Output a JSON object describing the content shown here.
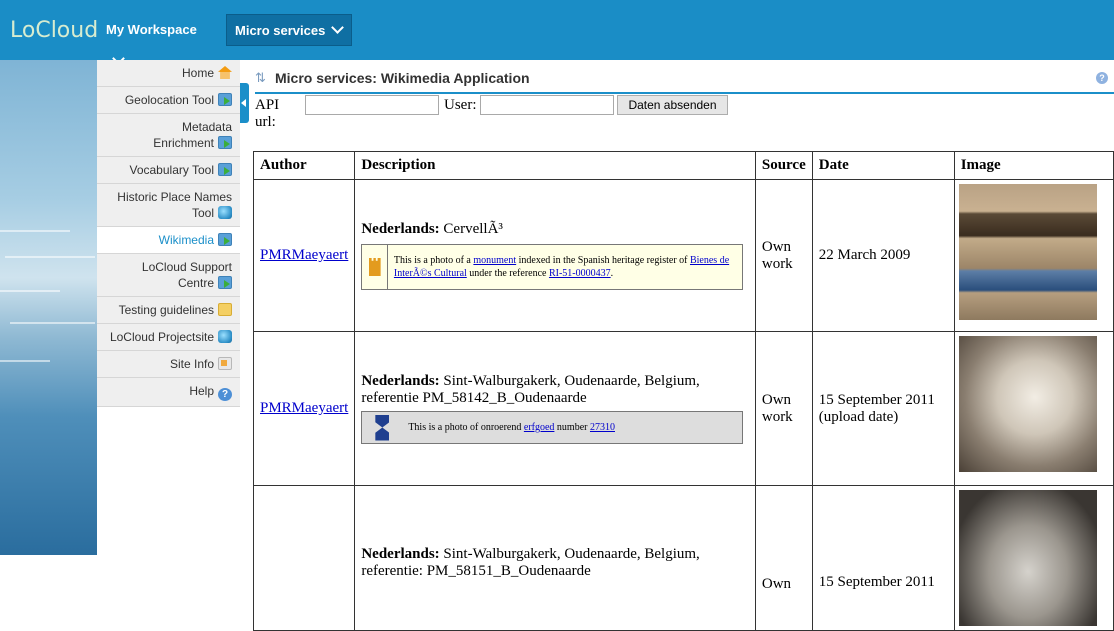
{
  "topbar": {
    "logo": "LoCloud",
    "menu_workspace": "My Workspace",
    "menu_micro": "Micro services"
  },
  "sidebar": {
    "items": [
      {
        "label": "Home",
        "icon": "home-icon"
      },
      {
        "label": "Geolocation Tool",
        "icon": "go-icon"
      },
      {
        "label": "Metadata Enrichment",
        "icon": "go-icon"
      },
      {
        "label": "Vocabulary Tool",
        "icon": "go-icon"
      },
      {
        "label": "Historic Place Names Tool",
        "icon": "database-icon"
      },
      {
        "label": "Wikimedia",
        "icon": "go-icon",
        "active": true
      },
      {
        "label": "LoCloud Support Centre",
        "icon": "go-icon"
      },
      {
        "label": "Testing guidelines",
        "icon": "folder-icon"
      },
      {
        "label": "LoCloud Projectsite",
        "icon": "database-icon"
      },
      {
        "label": "Site Info",
        "icon": "site-info-icon"
      },
      {
        "label": "Help",
        "icon": "help-icon"
      }
    ]
  },
  "header": {
    "title": "Micro services: Wikimedia Application"
  },
  "form": {
    "api_label": "API url:",
    "user_label": "User:",
    "api_value": "",
    "user_value": "",
    "submit_label": "Daten absenden"
  },
  "table": {
    "headers": [
      "Author",
      "Description",
      "Source",
      "Date",
      "Image"
    ],
    "rows": [
      {
        "author": "PMRMaeyaert",
        "desc_lang": "Nederlands:",
        "desc_text": "CervellÃ³",
        "box_pre": "This is a photo of a ",
        "box_link1": "monument",
        "box_mid": " indexed in the Spanish heritage register of ",
        "box_link2": "Bienes de InterÃ©s Cultural",
        "box_mid2": " under the reference ",
        "box_link3": "RI-51-0000437",
        "box_end": ".",
        "source": "Own work",
        "date": "22 March 2009"
      },
      {
        "author": "PMRMaeyaert",
        "desc_lang": "Nederlands:",
        "desc_text": "Sint-Walburgakerk, Oudenaarde, Belgium, referentie PM_58142_B_Oudenaarde",
        "box_pre": "This is a photo of onroerend ",
        "box_link1": "erfgoed",
        "box_mid": " number ",
        "box_link2": "27310",
        "source": "Own work",
        "date": "15 September 2011 (upload date)"
      },
      {
        "desc_lang": "Nederlands:",
        "desc_text": "Sint-Walburgakerk, Oudenaarde, Belgium, referentie: PM_58151_B_Oudenaarde",
        "source": "Own",
        "date": "15 September 2011"
      }
    ]
  }
}
